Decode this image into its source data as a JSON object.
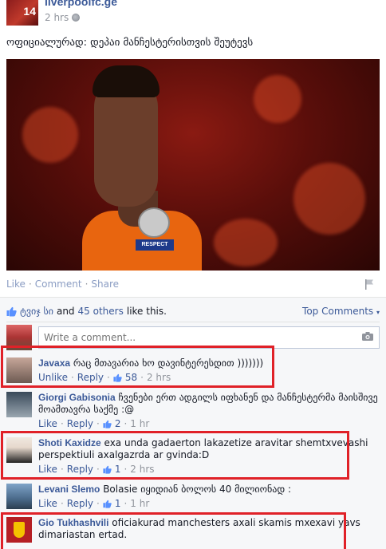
{
  "post": {
    "page_name": "liverpoolfc.ge",
    "timestamp": "2 hrs",
    "avatar_number": "14",
    "text": "ოფიციალურად: დეპაი მანჩესტერისთვის შეუტევს",
    "image_badge": "RESPECT",
    "actions": {
      "like": "Like",
      "comment": "Comment",
      "share": "Share",
      "sep": "·"
    }
  },
  "feedback": {
    "liker_name": "ტვიჯ სი",
    "and": "and",
    "others": "45 others",
    "suffix": "like this.",
    "top_comments": "Top Comments",
    "comment_placeholder": "Write a comment..."
  },
  "comments": [
    {
      "name": "Javaxa",
      "text": "რაც მთავარია ხო დავინტერესდით )))))))",
      "actions": [
        "Unlike",
        "Reply"
      ],
      "likes": "58",
      "time": "2 hrs",
      "highlighted": true
    },
    {
      "name": "Giorgi Gabisonia",
      "text": "ჩვენები ერთ ადგილს იფხანენ და მანჩესტერმა მაისშივე მოამთავრა საქმე :@",
      "actions": [
        "Like",
        "Reply"
      ],
      "likes": "2",
      "time": "1 hr",
      "highlighted": false
    },
    {
      "name": "Shoti Kaxidze",
      "text": "exa unda gadaerton lakazetize aravitar shemtxvevashi perspektiuli axalgazrda ar gvinda:D",
      "actions": [
        "Like",
        "Reply"
      ],
      "likes": "1",
      "time": "2 hrs",
      "highlighted": true
    },
    {
      "name": "Levani Slemo",
      "text": "Bolasie იყიდიან ბოლოს 40 მილიონად :",
      "actions": [
        "Like",
        "Reply"
      ],
      "likes": "1",
      "time": "1 hr",
      "highlighted": false
    },
    {
      "name": "Gio Tukhashvili",
      "text": "oficiakurad manchesters axali skamis mxexavi yavs dimariastan ertad.",
      "actions": [],
      "likes": "",
      "time": "",
      "highlighted": true
    }
  ],
  "colors": {
    "link": "#3b5998",
    "highlight": "#e02128",
    "jersey": "#e8650f",
    "muted": "#90949c"
  }
}
